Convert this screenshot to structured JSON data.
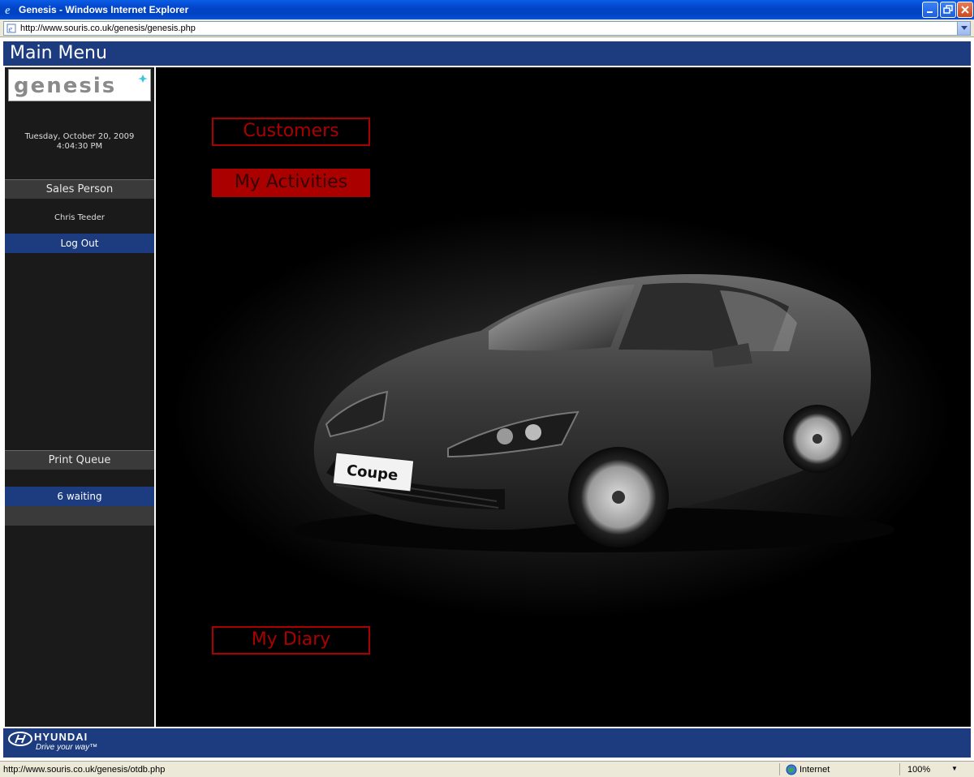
{
  "window": {
    "title": "Genesis - Windows Internet Explorer",
    "address_url": "http://www.souris.co.uk/genesis/genesis.php"
  },
  "header": {
    "title": "Main Menu"
  },
  "sidebar": {
    "logo_text": "genesis",
    "date": "Tuesday, October 20, 2009",
    "time": "4:04:30 PM",
    "sales_person_heading": "Sales Person",
    "sales_person_name": "Chris Teeder",
    "logout_label": "Log Out",
    "print_queue_heading": "Print Queue",
    "print_queue_status": "6 waiting"
  },
  "menu": {
    "items": [
      {
        "label": "Customers",
        "active": false
      },
      {
        "label": "My Activities",
        "active": true
      },
      {
        "label": "My Diary",
        "active": false
      }
    ]
  },
  "car": {
    "plate_text": "Coupe"
  },
  "footer": {
    "brand": "HYUNDAI",
    "tagline": "Drive your way™"
  },
  "statusbar": {
    "url": "http://www.souris.co.uk/genesis/otdb.php",
    "zone": "Internet",
    "zoom": "100%"
  },
  "colors": {
    "brand_blue": "#1c3c7f",
    "menu_red": "#aa0000",
    "sidebar_bg": "#1a1a1a"
  }
}
